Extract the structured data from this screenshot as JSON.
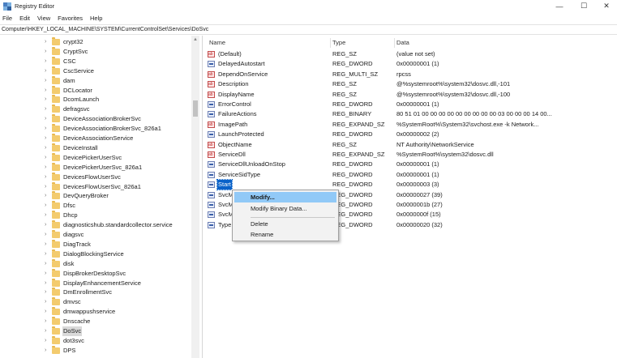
{
  "window": {
    "title": "Registry Editor",
    "controls": {
      "minimize": "—",
      "maximize": "☐",
      "close": "✕"
    }
  },
  "menu": [
    "File",
    "Edit",
    "View",
    "Favorites",
    "Help"
  ],
  "address": "Computer\\HKEY_LOCAL_MACHINE\\SYSTEM\\CurrentControlSet\\Services\\DoSvc",
  "tree": {
    "items": [
      "crypt32",
      "CryptSvc",
      "CSC",
      "CscService",
      "dam",
      "DCLocator",
      "DcomLaunch",
      "defragsvc",
      "DeviceAssociationBrokerSvc",
      "DeviceAssociationBrokerSvc_826a1",
      "DeviceAssociationService",
      "DeviceInstall",
      "DevicePickerUserSvc",
      "DevicePickerUserSvc_826a1",
      "DevicesFlowUserSvc",
      "DevicesFlowUserSvc_826a1",
      "DevQueryBroker",
      "Dfsc",
      "Dhcp",
      "diagnosticshub.standardcollector.service",
      "diagsvc",
      "DiagTrack",
      "DialogBlockingService",
      "disk",
      "DispBrokerDesktopSvc",
      "DisplayEnhancementService",
      "DmEnrollmentSvc",
      "dmvsc",
      "dmwappushservice",
      "Dnscache",
      "DoSvc",
      "dot3svc",
      "DPS"
    ],
    "selected_index": 30
  },
  "columns": {
    "name": "Name",
    "type": "Type",
    "data": "Data"
  },
  "values": [
    {
      "icon": "string-value-icon",
      "name": "(Default)",
      "type": "REG_SZ",
      "data": "(value not set)"
    },
    {
      "icon": "binary-value-icon",
      "name": "DelayedAutostart",
      "type": "REG_DWORD",
      "data": "0x00000001 (1)"
    },
    {
      "icon": "string-value-icon",
      "name": "DependOnService",
      "type": "REG_MULTI_SZ",
      "data": "rpcss"
    },
    {
      "icon": "string-value-icon",
      "name": "Description",
      "type": "REG_SZ",
      "data": "@%systemroot%\\system32\\dosvc.dll,-101"
    },
    {
      "icon": "string-value-icon",
      "name": "DisplayName",
      "type": "REG_SZ",
      "data": "@%systemroot%\\system32\\dosvc.dll,-100"
    },
    {
      "icon": "binary-value-icon",
      "name": "ErrorControl",
      "type": "REG_DWORD",
      "data": "0x00000001 (1)"
    },
    {
      "icon": "binary-value-icon",
      "name": "FailureActions",
      "type": "REG_BINARY",
      "data": "80 51 01 00 00 00 00 00 00 00 00 00 03 00 00 00 14 00..."
    },
    {
      "icon": "string-value-icon",
      "name": "ImagePath",
      "type": "REG_EXPAND_SZ",
      "data": "%SystemRoot%\\System32\\svchost.exe -k Network..."
    },
    {
      "icon": "binary-value-icon",
      "name": "LaunchProtected",
      "type": "REG_DWORD",
      "data": "0x00000002 (2)"
    },
    {
      "icon": "string-value-icon",
      "name": "ObjectName",
      "type": "REG_SZ",
      "data": "NT Authority\\NetworkService"
    },
    {
      "icon": "string-value-icon",
      "name": "ServiceDll",
      "type": "REG_EXPAND_SZ",
      "data": "%SystemRoot%\\system32\\dosvc.dll"
    },
    {
      "icon": "binary-value-icon",
      "name": "ServiceDllUnloadOnStop",
      "type": "REG_DWORD",
      "data": "0x00000001 (1)"
    },
    {
      "icon": "binary-value-icon",
      "name": "ServiceSidType",
      "type": "REG_DWORD",
      "data": "0x00000001 (1)"
    },
    {
      "icon": "binary-value-icon",
      "name": "Start",
      "type": "REG_DWORD",
      "data": "0x00000003 (3)"
    },
    {
      "icon": "binary-value-icon",
      "name": "SvcM",
      "type": "REG_DWORD",
      "data": "0x00000027 (39)"
    },
    {
      "icon": "binary-value-icon",
      "name": "SvcM",
      "type": "REG_DWORD",
      "data": "0x0000001b (27)"
    },
    {
      "icon": "binary-value-icon",
      "name": "SvcM",
      "type": "REG_DWORD",
      "data": "0x0000000f (15)"
    },
    {
      "icon": "binary-value-icon",
      "name": "Type",
      "type": "REG_DWORD",
      "data": "0x00000020 (32)"
    }
  ],
  "selected_value_index": 13,
  "context_menu": {
    "items": [
      "Modify...",
      "Modify Binary Data...",
      "Delete",
      "Rename"
    ],
    "highlighted_index": 0
  },
  "colors": {
    "selection": "#0a62c9",
    "menu_highlight": "#91c9f7",
    "folder": "#f3cb6e"
  }
}
